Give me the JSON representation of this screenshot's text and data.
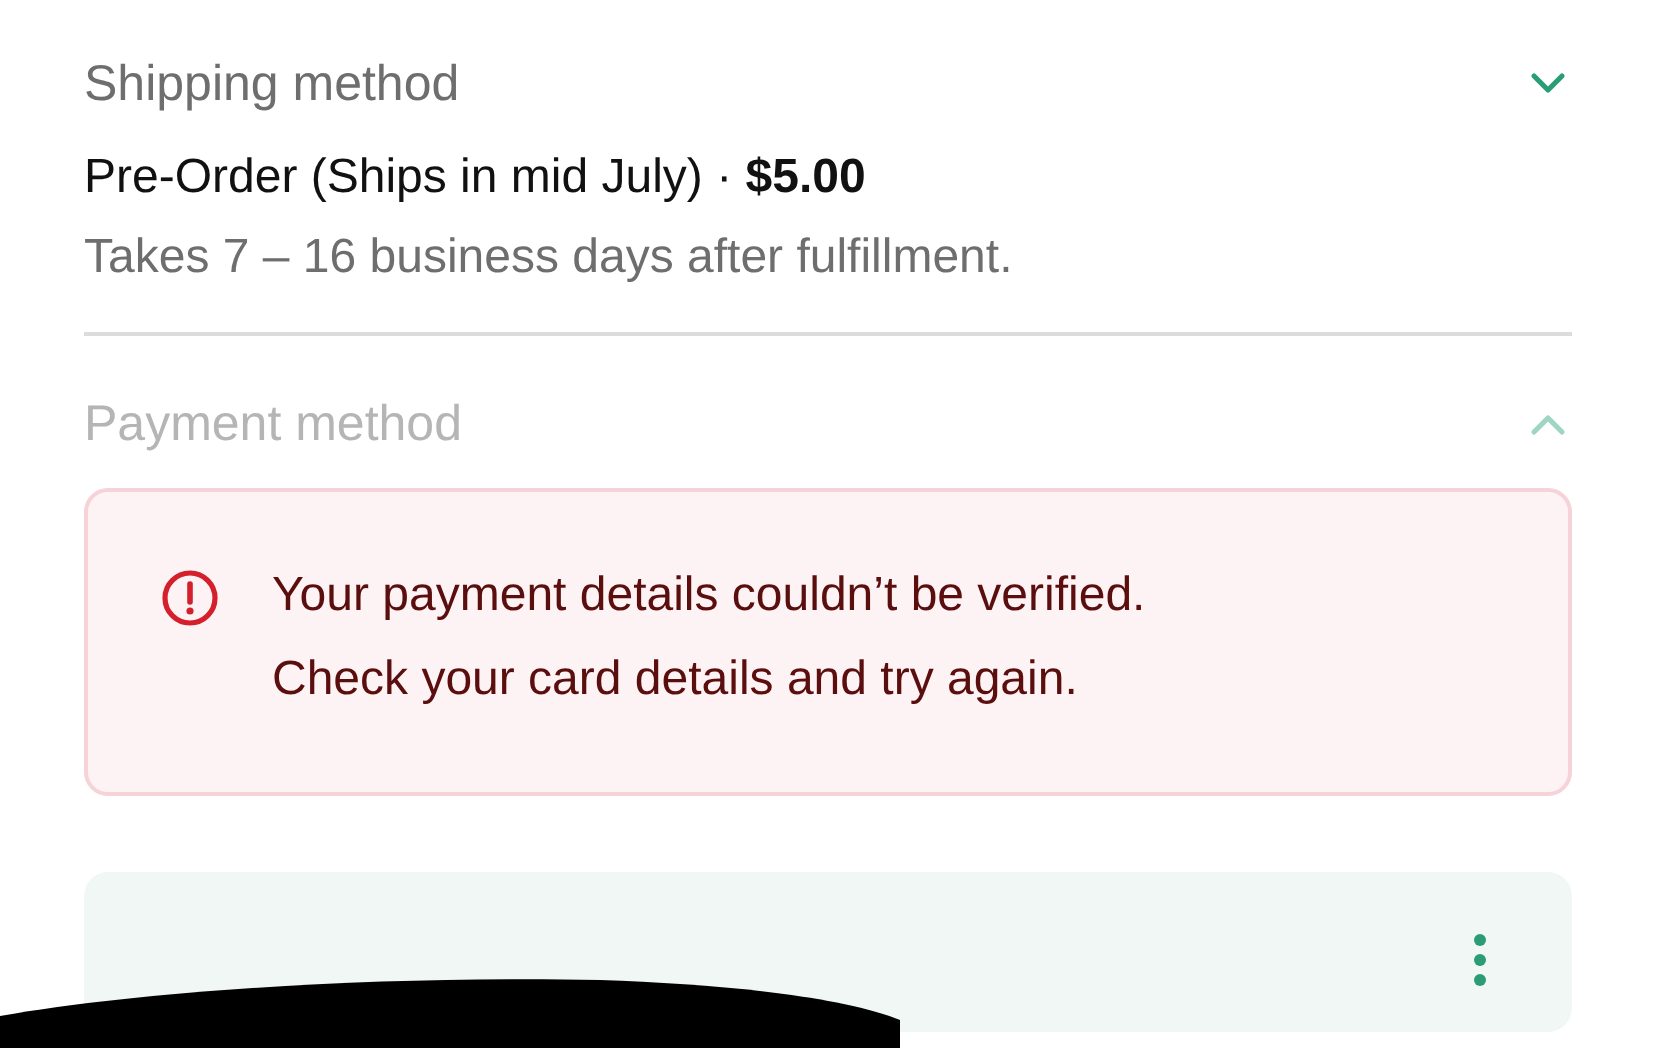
{
  "sections": [
    {
      "title": "Shipping method",
      "expanded": false,
      "summary": "Pre-Order (Ships in mid July) · **$5.00**",
      "detail": "Takes 7 – 16 business days after fulfillment."
    },
    {
      "title": "Payment method",
      "expanded": true,
      "error": [
        "Your payment details couldn’t be verified.",
        "Check your card details and try again."
      ]
    }
  ]
}
